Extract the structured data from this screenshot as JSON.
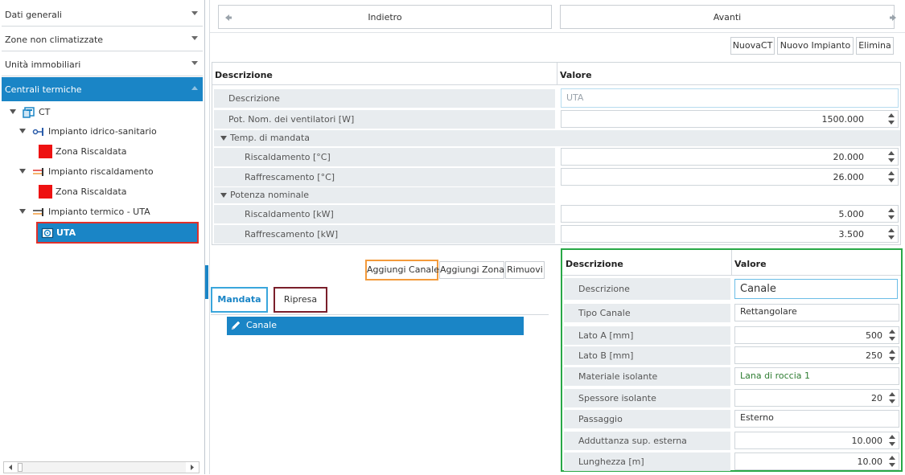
{
  "sidebar": {
    "sections": [
      {
        "label": "Dati generali"
      },
      {
        "label": "Zone non climatizzate"
      },
      {
        "label": "Unità immobiliari"
      },
      {
        "label": "Centrali termiche"
      }
    ],
    "tree": [
      {
        "label": "CT",
        "icon": "ct-icon"
      },
      {
        "label": "Impianto idrico-sanitario",
        "icon": "plant-sanitary-icon"
      },
      {
        "label": "Zona Riscaldata",
        "icon": "zone-icon"
      },
      {
        "label": "Impianto riscaldamento",
        "icon": "plant-heating-icon"
      },
      {
        "label": "Zona Riscaldata",
        "icon": "zone-icon"
      },
      {
        "label": "Impianto termico - UTA",
        "icon": "plant-uta-icon"
      },
      {
        "label": "UTA",
        "icon": "uta-icon"
      }
    ]
  },
  "nav": {
    "back": "Indietro",
    "forward": "Avanti"
  },
  "toolbar": {
    "new_ct": "NuovaCT",
    "new_plant": "Nuovo Impianto",
    "delete": "Elimina"
  },
  "props": {
    "col_desc": "Descrizione",
    "col_value": "Valore",
    "rows": {
      "descrizione": {
        "label": "Descrizione",
        "value": "UTA"
      },
      "pot_nom": {
        "label": "Pot. Nom. dei ventilatori [W]",
        "value": "1500.000"
      },
      "group_temp": "Temp. di mandata",
      "risc_temp": {
        "label": "Riscaldamento [°C]",
        "value": "20.000"
      },
      "raff_temp": {
        "label": "Raffrescamento [°C]",
        "value": "26.000"
      },
      "group_pot": "Potenza nominale",
      "risc_pot": {
        "label": "Riscaldamento [kW]",
        "value": "5.000"
      },
      "raff_pot": {
        "label": "Raffrescamento [kW]",
        "value": "3.500"
      }
    }
  },
  "channel_toolbar": {
    "add_channel": "Aggiungi Canale",
    "add_zone": "Aggiungi Zona",
    "remove": "Rimuovi"
  },
  "tabs": {
    "mandata": "Mandata",
    "ripresa": "Ripresa"
  },
  "channels": [
    {
      "label": "Canale"
    }
  ],
  "canal_props": {
    "col_desc": "Descrizione",
    "col_value": "Valore",
    "rows": {
      "descrizione": {
        "label": "Descrizione",
        "value": "Canale"
      },
      "tipo": {
        "label": "Tipo Canale",
        "value": "Rettangolare"
      },
      "lato_a": {
        "label": "Lato A [mm]",
        "value": "500"
      },
      "lato_b": {
        "label": "Lato B [mm]",
        "value": "250"
      },
      "materiale": {
        "label": "Materiale isolante",
        "value": "Lana di roccia 1"
      },
      "spessore": {
        "label": "Spessore isolante",
        "value": "20"
      },
      "passaggio": {
        "label": "Passaggio",
        "value": "Esterno"
      },
      "adduttanza": {
        "label": "Adduttanza sup. esterna",
        "value": "10.000"
      },
      "lunghezza": {
        "label": "Lunghezza [m]",
        "value": "10.00"
      }
    }
  },
  "colors": {
    "accent": "#1a85c6",
    "highlight_red": "#e0302a",
    "highlight_orange": "#f39a3b",
    "highlight_blue": "#3aa6dc",
    "highlight_maroon": "#7a1f2b",
    "highlight_green": "#29a847",
    "material_green": "#2e7d32"
  }
}
